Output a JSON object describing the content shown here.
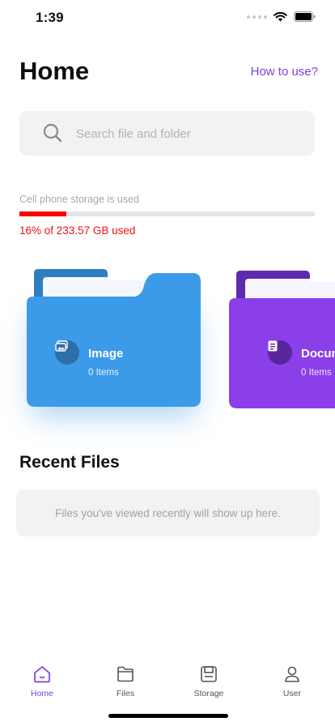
{
  "status_bar": {
    "time": "1:39",
    "icons": [
      "signal-dots-icon",
      "wifi-icon",
      "battery-icon"
    ]
  },
  "header": {
    "title": "Home",
    "help_link": "How to use?"
  },
  "search": {
    "placeholder": "Search file and folder",
    "icon": "search-icon"
  },
  "storage": {
    "label": "Cell phone storage is used",
    "used_text": "16% of 233.57 GB used",
    "used_fraction": 0.16,
    "bar_color": "#ff0000"
  },
  "folders": [
    {
      "name": "Image",
      "count_text": "0 Items",
      "color": "#3c9be8",
      "tab_color": "#2e7fc1",
      "icon": "image-icon"
    },
    {
      "name": "Document",
      "count_text": "0 Items",
      "color": "#8a3fe8",
      "tab_color": "#5d2ab0",
      "icon": "document-icon"
    }
  ],
  "recent": {
    "title": "Recent Files",
    "empty_text": "Files you've viewed recently will show up here."
  },
  "tabs": [
    {
      "label": "Home",
      "icon": "home-icon",
      "active": true
    },
    {
      "label": "Files",
      "icon": "folder-icon",
      "active": false
    },
    {
      "label": "Storage",
      "icon": "storage-icon",
      "active": false
    },
    {
      "label": "User",
      "icon": "user-icon",
      "active": false
    }
  ],
  "accent_color": "#7b3fe4"
}
